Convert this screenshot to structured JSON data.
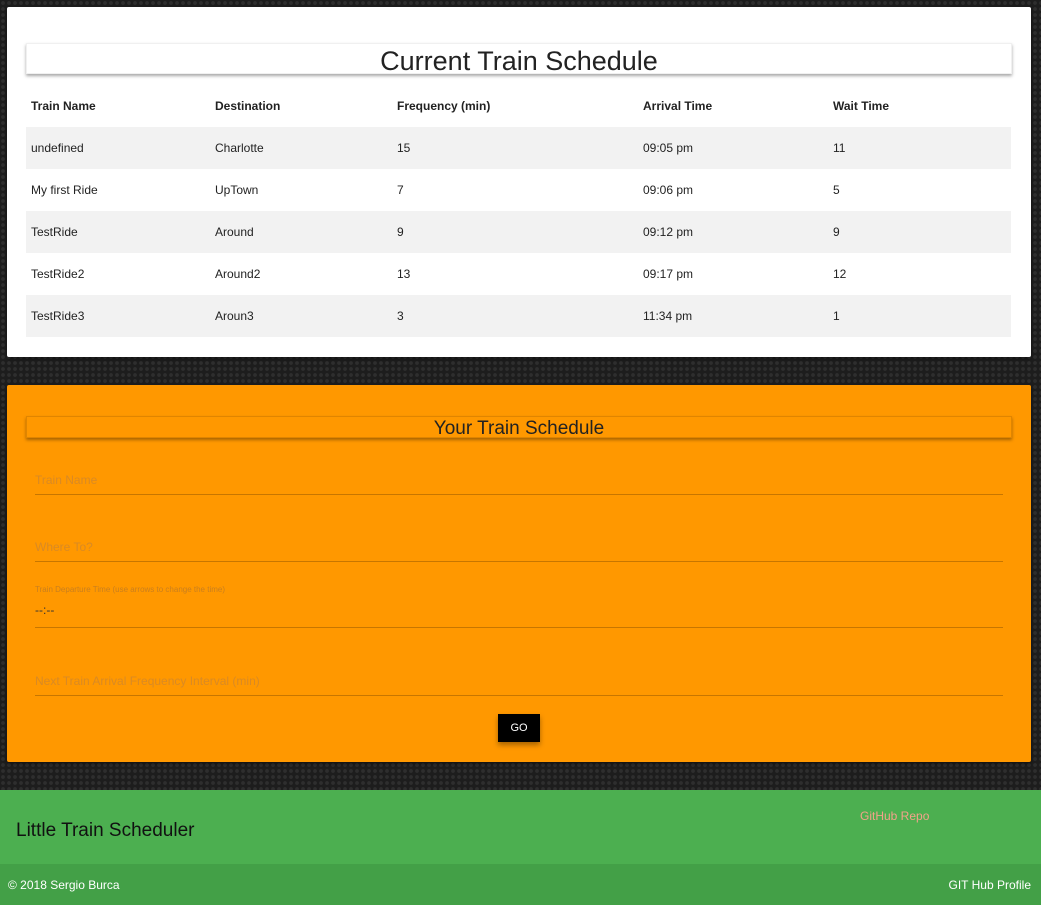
{
  "schedule": {
    "title": "Current Train Schedule",
    "columns": [
      "Train Name",
      "Destination",
      "Frequency (min)",
      "Arrival Time",
      "Wait Time"
    ],
    "rows": [
      [
        "undefined",
        "Charlotte",
        "15",
        "09:05 pm",
        "11"
      ],
      [
        "My first Ride",
        "UpTown",
        "7",
        "09:06 pm",
        "5"
      ],
      [
        "TestRide",
        "Around",
        "9",
        "09:12 pm",
        "9"
      ],
      [
        "TestRide2",
        "Around2",
        "13",
        "09:17 pm",
        "12"
      ],
      [
        "TestRide3",
        "Aroun3",
        "3",
        "11:34 pm",
        "1"
      ]
    ]
  },
  "form": {
    "title": "Your Train Schedule",
    "train_name_placeholder": "Train Name",
    "destination_placeholder": "Where To?",
    "departure_label": "Train Departure Time (use arrows to change the time)",
    "departure_value": "--:--",
    "frequency_placeholder": "Next Train Arrival Frequency Interval (min)",
    "go_label": "GO"
  },
  "footer": {
    "title": "Little Train Scheduler",
    "repo_link": "GitHub Repo",
    "copyright": "© 2018 Sergio Burca",
    "profile_link": "GIT Hub Profile"
  },
  "colors": {
    "form_background": "#ff9800",
    "footer_background": "#4caf50",
    "button_background": "#000000"
  }
}
